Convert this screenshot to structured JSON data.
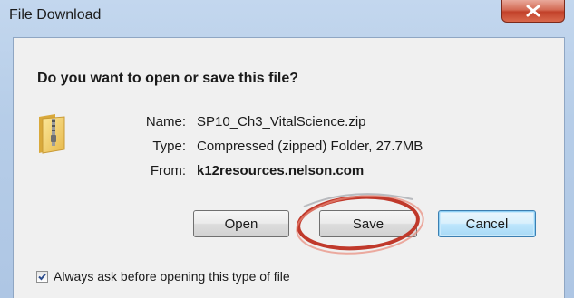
{
  "window": {
    "title": "File Download",
    "close_glyph": "X"
  },
  "dialog": {
    "question": "Do you want to open or save this file?",
    "icon": "zip-folder-icon",
    "fields": [
      {
        "label": "Name:",
        "value": "SP10_Ch3_VitalScience.zip",
        "bold": false
      },
      {
        "label": "Type:",
        "value": "Compressed (zipped) Folder, 27.7MB",
        "bold": false
      },
      {
        "label": "From:",
        "value": "k12resources.nelson.com",
        "bold": true
      }
    ],
    "buttons": {
      "open": "Open",
      "save": "Save",
      "cancel": "Cancel"
    },
    "checkbox": {
      "label": "Always ask before opening this type of file",
      "checked": true
    }
  },
  "colors": {
    "annotation_ring": "#c0392b",
    "default_button_border": "#3c7fb1"
  }
}
